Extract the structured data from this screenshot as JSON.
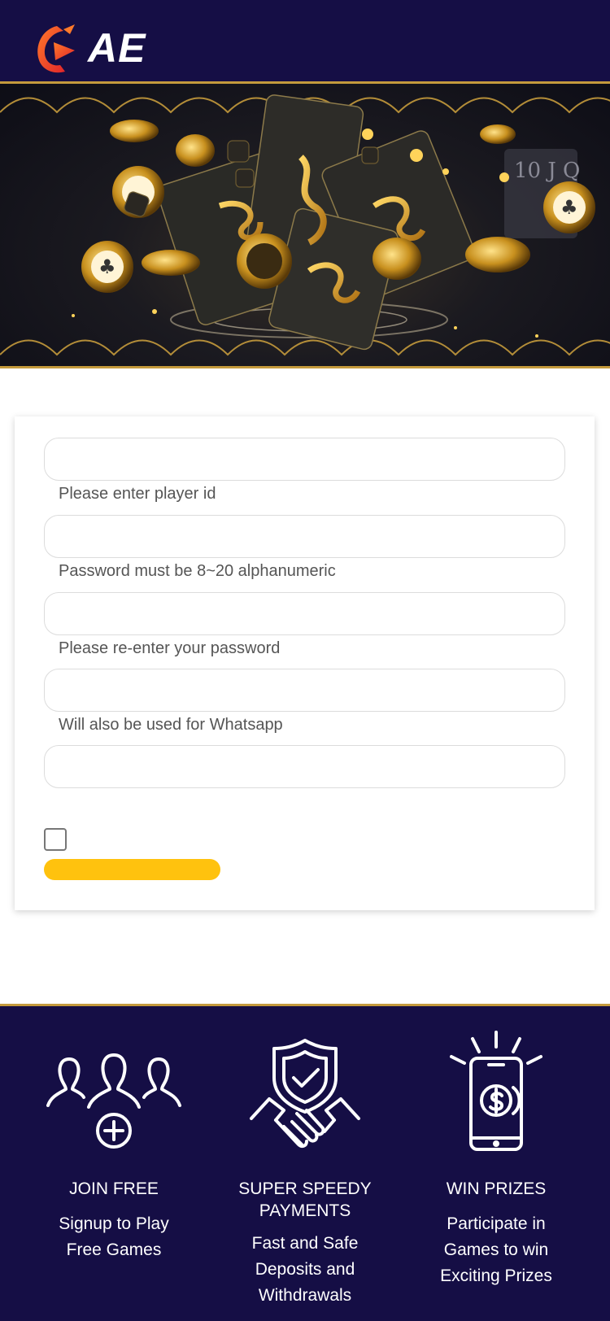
{
  "header": {
    "logo_text": "AE",
    "brand_color": "#150e45"
  },
  "banner": {
    "accent_color": "#c49a3c"
  },
  "form": {
    "fields": [
      {
        "value": "",
        "hint": "Please enter player id"
      },
      {
        "value": "",
        "hint": "Password must be 8~20 alphanumeric"
      },
      {
        "value": "",
        "hint": "Please re-enter your password"
      },
      {
        "value": "",
        "hint": "Will also be used for Whatsapp"
      },
      {
        "value": ""
      }
    ],
    "checkbox_checked": false,
    "submit_label": "",
    "submit_color": "#ffc20e"
  },
  "features": [
    {
      "icon": "users-plus-icon",
      "title": "JOIN FREE",
      "desc_lines": [
        "Signup to Play",
        "Free Games"
      ]
    },
    {
      "icon": "shield-handshake-icon",
      "title_lines": [
        "SUPER SPEEDY",
        "PAYMENTS"
      ],
      "desc_lines": [
        "Fast and Safe",
        "Deposits and",
        "Withdrawals"
      ]
    },
    {
      "icon": "phone-prize-icon",
      "title": "WIN PRIZES",
      "desc_lines": [
        "Participate in",
        "Games to win",
        "Exciting Prizes"
      ]
    }
  ]
}
